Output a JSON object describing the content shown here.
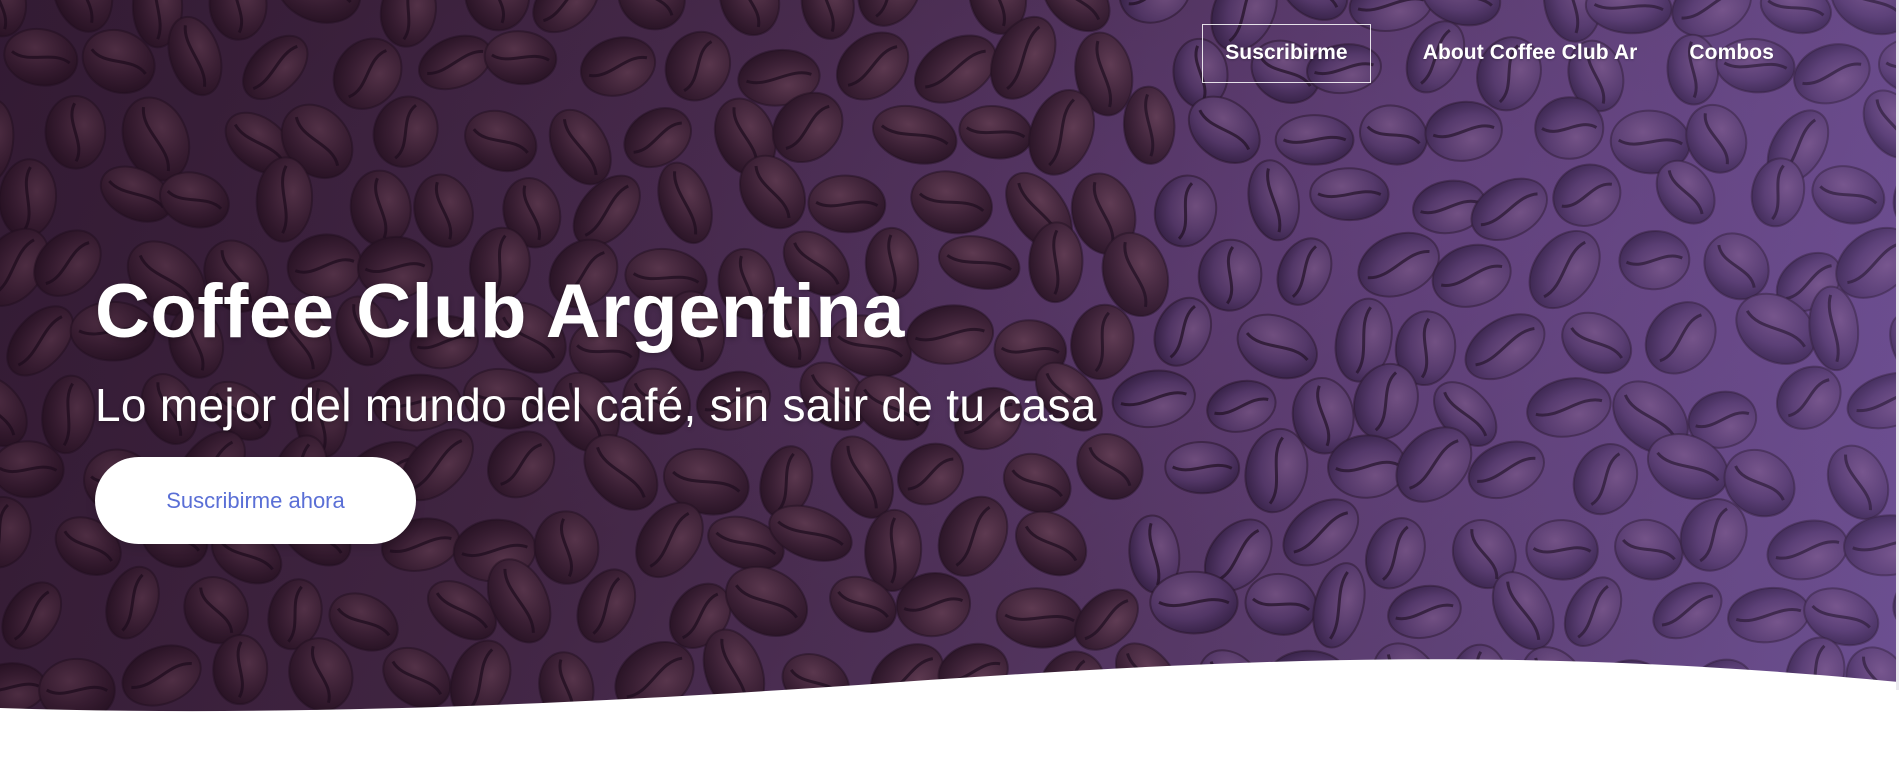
{
  "nav": {
    "items": [
      {
        "label": "Suscribirme",
        "outlined": true
      },
      {
        "label": "About Coffee Club Ar",
        "outlined": false
      },
      {
        "label": "Combos",
        "outlined": false
      }
    ]
  },
  "hero": {
    "title": "Coffee Club Argentina",
    "subtitle": "Lo mejor del mundo del café, sin salir de tu casa",
    "cta_label": "Suscribirme ahora",
    "background": "coffee-beans-image"
  },
  "colors": {
    "cta_text": "#5a6fd6",
    "overlay": "#5b3d66",
    "wave": "#ffffff"
  }
}
